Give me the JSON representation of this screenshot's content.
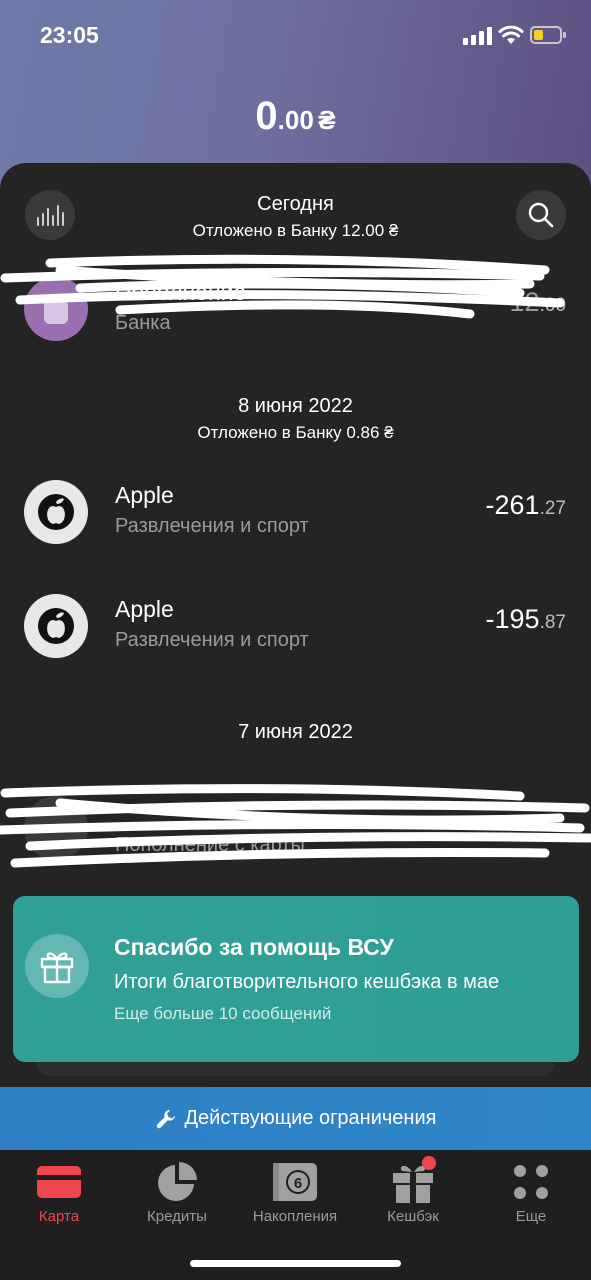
{
  "status_bar": {
    "time": "23:05",
    "battery_color": "#f2d21f"
  },
  "balance": {
    "whole": "0",
    "fraction": ".00",
    "currency": "₴"
  },
  "sections": [
    {
      "title": "Сегодня",
      "subtitle": "Отложено в Банку 12.00 ₴"
    },
    {
      "title": "8 июня 2022",
      "subtitle": "Отложено в Банку 0.86 ₴"
    },
    {
      "title": "7 июня 2022"
    }
  ],
  "transactions": [
    {
      "name": "Пополнение",
      "category": "Банка",
      "amount_main": "12",
      "amount_cents": ".00",
      "icon": "jar-icon",
      "partially_obscured": true
    },
    {
      "name": "Apple",
      "category": "Развлечения и спорт",
      "amount_main": "-261",
      "amount_cents": ".27",
      "icon": "apple-icon"
    },
    {
      "name": "Apple",
      "category": "Развлечения и спорт",
      "amount_main": "-195",
      "amount_cents": ".87",
      "icon": "apple-icon"
    },
    {
      "name": "",
      "category": "Пополнение с карты",
      "amount_main": "",
      "amount_cents": "",
      "icon": "download-icon",
      "partially_obscured": true
    }
  ],
  "promo": {
    "title": "Спасибо за помощь ВСУ",
    "text": "Итоги благотворительного кешбэка в мае",
    "more": "Еще больше 10 сообщений",
    "icon": "gift-icon",
    "color": "#30a097"
  },
  "limits_bar": {
    "label": "Действующие ограничения",
    "icon": "wrench-icon",
    "color": "#2e7fc4"
  },
  "tabs": [
    {
      "label": "Карта",
      "icon": "card-icon",
      "active": true
    },
    {
      "label": "Кредиты",
      "icon": "pie-chart-icon"
    },
    {
      "label": "Накопления",
      "icon": "safe-icon",
      "badge_text": "6"
    },
    {
      "label": "Кешбэк",
      "icon": "gift-icon",
      "has_notification_dot": true
    },
    {
      "label": "Еще",
      "icon": "more-dots-icon"
    }
  ],
  "colors": {
    "accent": "#f0474f",
    "background": "#242424"
  }
}
